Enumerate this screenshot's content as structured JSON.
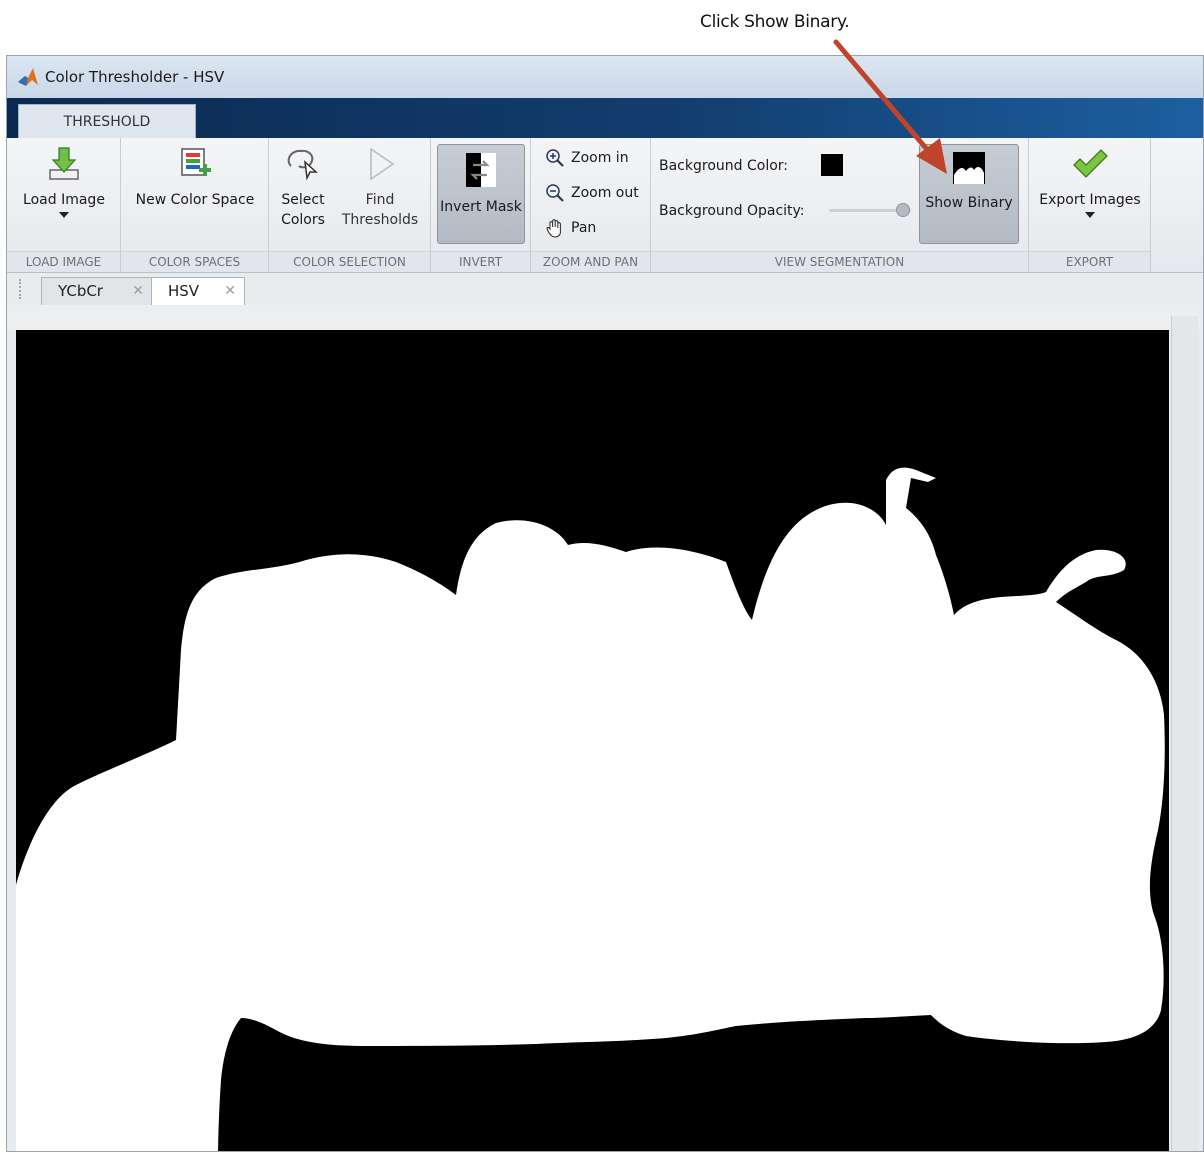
{
  "annotation": {
    "text": "Click Show Binary."
  },
  "window": {
    "title": "Color Thresholder - HSV"
  },
  "ribbon": {
    "tab": "THRESHOLD",
    "sections": {
      "load_image": {
        "label": "LOAD IMAGE",
        "button": "Load Image"
      },
      "color_spaces": {
        "label": "COLOR SPACES",
        "button": "New Color Space"
      },
      "color_selection": {
        "label": "COLOR SELECTION",
        "select_line1": "Select",
        "select_line2": "Colors",
        "find_line1": "Find",
        "find_line2": "Thresholds"
      },
      "invert": {
        "label": "INVERT",
        "button": "Invert Mask"
      },
      "zoom_pan": {
        "label": "ZOOM AND PAN",
        "zoom_in": "Zoom in",
        "zoom_out": "Zoom out",
        "pan": "Pan"
      },
      "view_segmentation": {
        "label": "VIEW SEGMENTATION",
        "bg_color": "Background Color:",
        "bg_opacity": "Background Opacity:",
        "show_binary": "Show Binary",
        "bg_color_value": "#000000"
      },
      "export": {
        "label": "EXPORT",
        "button": "Export Images"
      }
    }
  },
  "document_tabs": [
    {
      "label": "YCbCr",
      "active": false
    },
    {
      "label": "HSV",
      "active": true
    }
  ],
  "colors": {
    "accent_arrow": "#c0442b",
    "mask_fg": "#ffffff",
    "mask_bg": "#000000"
  }
}
